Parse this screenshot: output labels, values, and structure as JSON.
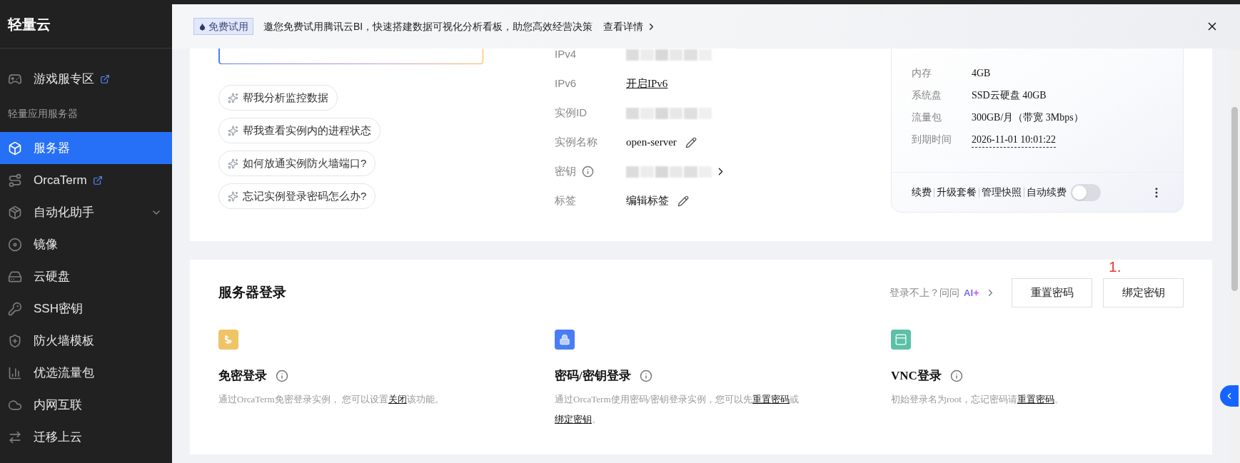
{
  "sidebar": {
    "title": "轻量云",
    "items": [
      {
        "kind": "item",
        "label": "游戏服专区",
        "external": true,
        "selected": false
      },
      {
        "kind": "section",
        "label": "轻量应用服务器"
      },
      {
        "kind": "item",
        "label": "服务器",
        "external": false,
        "selected": true
      },
      {
        "kind": "item",
        "label": "OrcaTerm",
        "external": true,
        "selected": false
      },
      {
        "kind": "group",
        "label": "自动化助手",
        "expanded": false,
        "selected": false
      },
      {
        "kind": "item",
        "label": "镜像",
        "external": false,
        "selected": false
      },
      {
        "kind": "item",
        "label": "云硬盘",
        "external": false,
        "selected": false
      },
      {
        "kind": "item",
        "label": "SSH密钥",
        "external": false,
        "selected": false
      },
      {
        "kind": "item",
        "label": "防火墙模板",
        "external": false,
        "selected": false
      },
      {
        "kind": "item",
        "label": "优选流量包",
        "external": false,
        "selected": false
      },
      {
        "kind": "item",
        "label": "内网互联",
        "external": false,
        "selected": false
      },
      {
        "kind": "item",
        "label": "迁移上云",
        "external": false,
        "selected": false
      }
    ]
  },
  "banner": {
    "badge": "免费试用",
    "message": "邀您免费试用腾讯云BI，快速搭建数据可视化分析看板，助您高效经营决策",
    "link": "查看详情"
  },
  "assistant": {
    "suggestions": [
      "帮我分析监控数据",
      "帮我查看实例内的进程状态",
      "如何放通实例防火墙端口?",
      "忘记实例登录密码怎么办?"
    ]
  },
  "instance": {
    "fields": [
      {
        "label": "IPv4",
        "kind": "masked",
        "info": false
      },
      {
        "label": "IPv6",
        "kind": "link",
        "value": "开启IPv6",
        "info": false
      },
      {
        "label": "实例ID",
        "kind": "masked",
        "info": false
      },
      {
        "label": "实例名称",
        "kind": "editable",
        "value": "open-server",
        "info": false
      },
      {
        "label": "密钥",
        "kind": "masked_link",
        "info": true
      },
      {
        "label": "标签",
        "kind": "editable",
        "value": "编辑标签",
        "info": false
      }
    ]
  },
  "specs": {
    "rows": [
      {
        "label": "内存",
        "value": "4GB",
        "dashed": false
      },
      {
        "label": "系统盘",
        "value": "SSD云硬盘 40GB",
        "dashed": false
      },
      {
        "label": "流量包",
        "value": "300GB/月（带宽 3Mbps）",
        "dashed": false
      },
      {
        "label": "到期时间",
        "value": "2026-11-01 10:01:22",
        "dashed": true
      }
    ],
    "actions": [
      "续费",
      "升级套餐",
      "管理快照"
    ],
    "auto_renew": {
      "label": "自动续费",
      "on": false
    }
  },
  "login": {
    "title": "服务器登录",
    "help": "登录不上？问问",
    "ai_badge": "AI",
    "buttons": [
      "重置密码",
      "绑定密钥"
    ],
    "annotation": "1.",
    "methods": [
      {
        "title": "免密登录",
        "description": [
          {
            "text": "通过OrcaTerm免密登录实例， 您可以设置"
          },
          {
            "text": "关闭",
            "link": true
          },
          {
            "text": "该功能。"
          }
        ]
      },
      {
        "title": "密码/密钥登录",
        "description": [
          {
            "text": "通过OrcaTerm使用密码/密钥登录实例，您可以先"
          },
          {
            "text": "重置密码",
            "link": true
          },
          {
            "text": "或"
          },
          {
            "text": "绑定密钥",
            "link": true
          },
          {
            "text": "。"
          }
        ]
      },
      {
        "title": "VNC登录",
        "description": [
          {
            "text": "初始登录名为root，忘记密码请"
          },
          {
            "text": "重置密码",
            "link": true
          },
          {
            "text": "。"
          }
        ]
      }
    ]
  }
}
